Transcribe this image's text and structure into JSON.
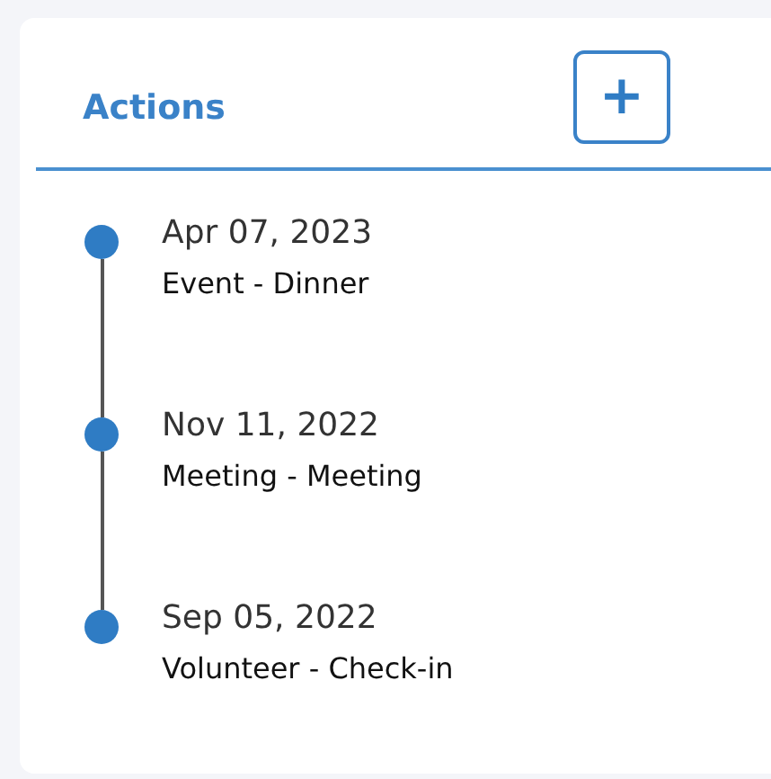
{
  "panel": {
    "title": "Actions",
    "add_button": "+"
  },
  "timeline": [
    {
      "date": "Apr 07, 2023",
      "description": "Event - Dinner"
    },
    {
      "date": "Nov 11, 2022",
      "description": "Meeting - Meeting"
    },
    {
      "date": "Sep 05, 2022",
      "description": "Volunteer - Check-in"
    }
  ]
}
